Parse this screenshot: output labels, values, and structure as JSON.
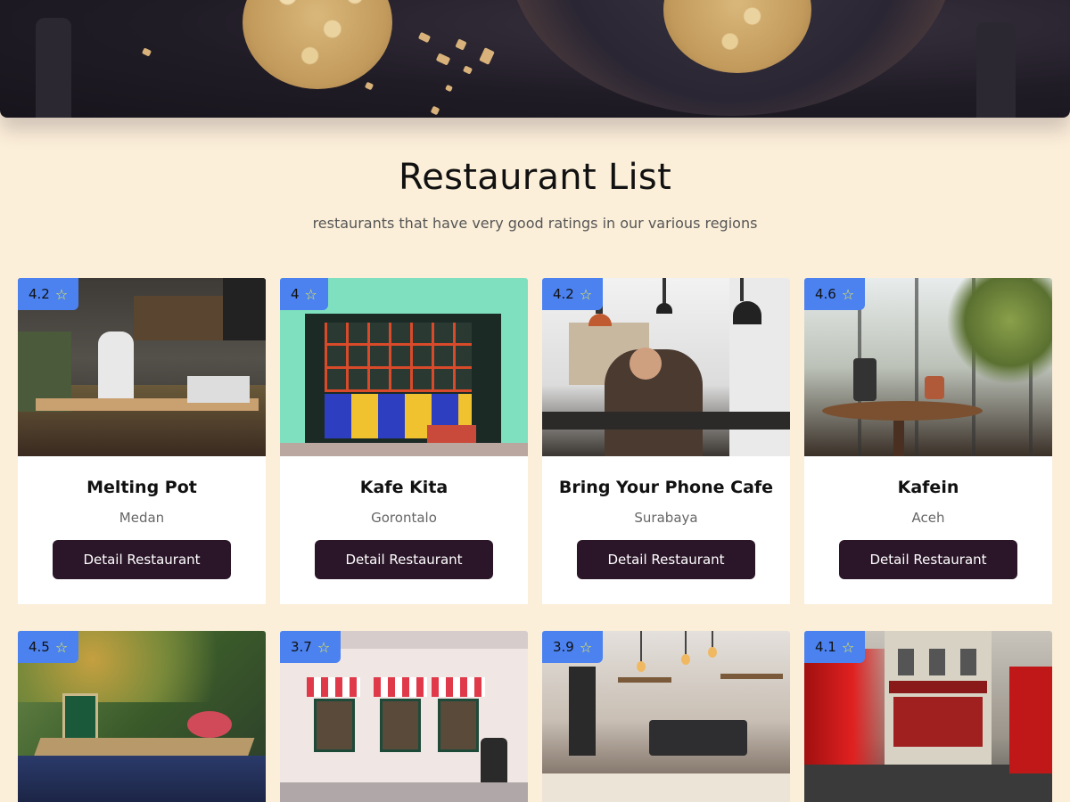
{
  "page": {
    "title": "Restaurant List",
    "subtitle": "restaurants that have very good ratings in our various regions"
  },
  "colors": {
    "background": "#fcefd9",
    "accent": "#4b82f0",
    "button": "#2b1629",
    "star": "#f5ef3a"
  },
  "restaurants": [
    {
      "name": "Melting Pot",
      "city": "Medan",
      "rating": "4.2",
      "button_label": "Detail Restaurant",
      "scene": "kitchen"
    },
    {
      "name": "Kafe Kita",
      "city": "Gorontalo",
      "rating": "4",
      "button_label": "Detail Restaurant",
      "scene": "storefront-mint"
    },
    {
      "name": "Bring Your Phone Cafe",
      "city": "Surabaya",
      "rating": "4.2",
      "button_label": "Detail Restaurant",
      "scene": "cafe-interior"
    },
    {
      "name": "Kafein",
      "city": "Aceh",
      "rating": "4.6",
      "button_label": "Detail Restaurant",
      "scene": "greenhouse-table"
    },
    {
      "name": "",
      "city": "",
      "rating": "4.5",
      "button_label": "",
      "scene": "garden-terrace"
    },
    {
      "name": "",
      "city": "",
      "rating": "3.7",
      "button_label": "",
      "scene": "awning-shop"
    },
    {
      "name": "",
      "city": "",
      "rating": "3.9",
      "button_label": "",
      "scene": "coffee-bar"
    },
    {
      "name": "",
      "city": "",
      "rating": "4.1",
      "button_label": "",
      "scene": "london-street"
    }
  ],
  "icons": {
    "rating": "star-icon"
  }
}
